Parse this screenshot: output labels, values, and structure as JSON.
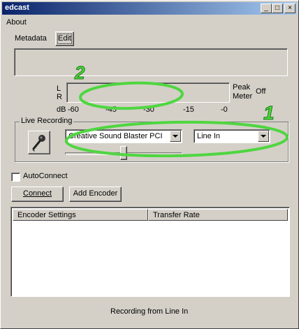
{
  "window": {
    "title": "edcast"
  },
  "title_buttons": {
    "minimize": "_",
    "maximize": "□",
    "close": "×"
  },
  "menu": {
    "items": [
      {
        "label": "About"
      }
    ]
  },
  "metadata": {
    "label": "Metadata",
    "edit_button": "Edit"
  },
  "meter": {
    "left_label": "L",
    "right_label": "R",
    "peak_label_line1": "Peak",
    "peak_label_line2": "Meter",
    "state": "Off",
    "db_label": "dB",
    "scale": [
      "-60",
      "-45",
      "-30",
      "-15",
      "-0"
    ]
  },
  "live_recording": {
    "title": "Live Recording",
    "device": "Creative Sound Blaster PCI",
    "input": "Line In",
    "slider_value": 0.5
  },
  "autoconnect": {
    "label": "AutoConnect",
    "checked": false
  },
  "buttons": {
    "connect": "Connect",
    "add_encoder": "Add Encoder"
  },
  "encoders": {
    "columns": [
      "Encoder Settings",
      "Transfer Rate"
    ],
    "rows": []
  },
  "status": "Recording from Line In",
  "annotations": {
    "one": "1",
    "two": "2"
  },
  "colors": {
    "annotation": "#4fd640",
    "title_start": "#0a246a",
    "title_end": "#a6caf0"
  }
}
